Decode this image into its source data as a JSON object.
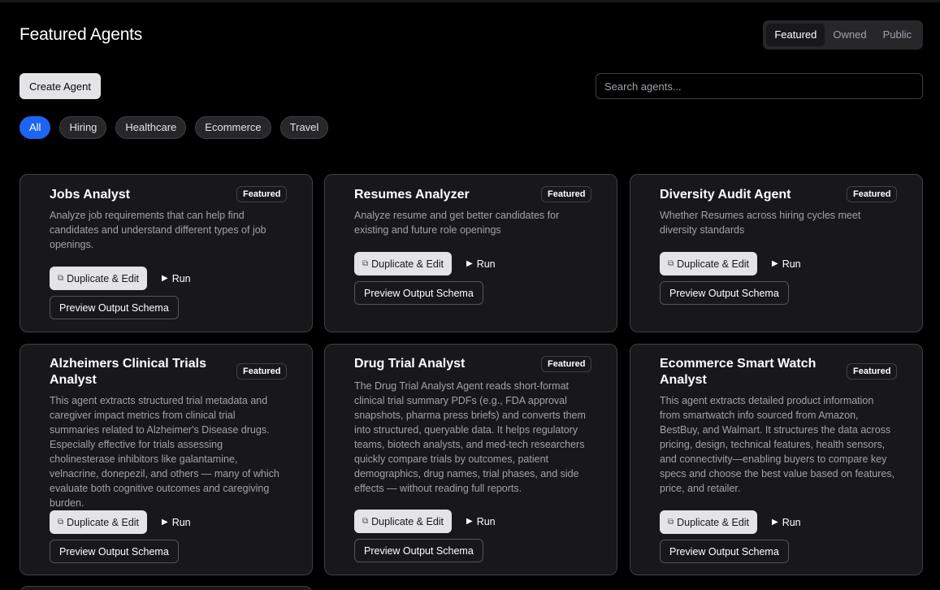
{
  "page": {
    "title": "Featured Agents"
  },
  "filter_tabs": [
    "Featured",
    "Owned",
    "Public"
  ],
  "actions": {
    "create_label": "Create Agent",
    "search_placeholder": "Search agents..."
  },
  "categories": [
    "All",
    "Hiring",
    "Healthcare",
    "Ecommerce",
    "Travel"
  ],
  "card_common": {
    "badge": "Featured",
    "duplicate_label": "Duplicate & Edit",
    "run_label": "Run",
    "schema_label": "Preview Output Schema",
    "duplicate_icon": "copy-icon",
    "run_icon": "play-icon"
  },
  "cards": [
    {
      "title": "Jobs Analyst",
      "description": "Analyze job requirements that can help find candidates and understand different types of job openings."
    },
    {
      "title": "Resumes Analyzer",
      "description": "Analyze resume and get better candidates for existing and future role openings"
    },
    {
      "title": "Diversity Audit Agent",
      "description": "Whether Resumes across hiring cycles meet diversity standards"
    },
    {
      "title": "Alzheimers Clinical Trials Analyst",
      "description": "This agent extracts structured trial metadata and caregiver impact metrics from clinical trial summaries related to Alzheimer's Disease drugs. Especially effective for trials assessing cholinesterase inhibitors like galantamine, velnacrine, donepezil, and others — many of which evaluate both cognitive outcomes and caregiving burden."
    },
    {
      "title": "Drug Trial Analyst",
      "description": "The Drug Trial Analyst Agent reads short-format clinical trial summary PDFs (e.g., FDA approval snapshots, pharma press briefs) and converts them into structured, queryable data. It helps regulatory teams, biotech analysts, and med-tech researchers quickly compare trials by outcomes, patient demographics, drug names, trial phases, and side effects — without reading full reports."
    },
    {
      "title": "Ecommerce Smart Watch Analyst",
      "description": "This agent extracts detailed product information from smartwatch info sourced from Amazon, BestBuy, and Walmart. It structures the data across pricing, design, technical features, health sensors, and connectivity—enabling buyers to compare key specs and choose the best value based on features, price, and retailer."
    }
  ],
  "colors": {
    "accent": "#1d64f2",
    "card_bg": "#18181b",
    "border": "#3f3f46",
    "muted_text": "#a1a1aa"
  }
}
